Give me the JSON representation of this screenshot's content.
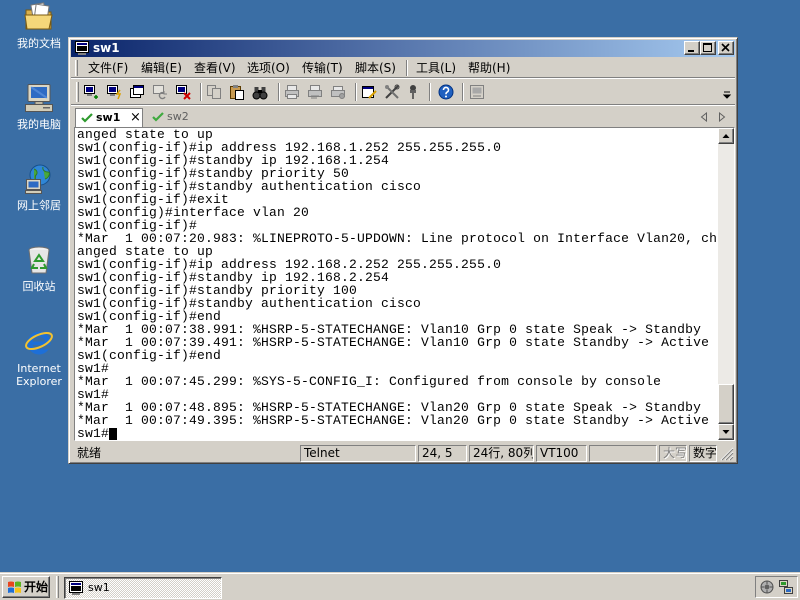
{
  "colors": {
    "desktop": "#3A6EA5",
    "face": "#D4D0C8",
    "title_gradient_start": "#0A246A",
    "title_gradient_end": "#A6CAF0",
    "terminal_background": "#FFFFFF",
    "terminal_text": "#000000"
  },
  "desktop": {
    "icons": [
      {
        "label": "我的文档",
        "icon": "my-documents-icon"
      },
      {
        "label": "我的电脑",
        "icon": "my-computer-icon"
      },
      {
        "label": "网上邻居",
        "icon": "network-places-icon"
      },
      {
        "label": "回收站",
        "icon": "recycle-bin-icon"
      },
      {
        "label": "Internet Explorer",
        "icon": "internet-explorer-icon"
      }
    ]
  },
  "window": {
    "title": "sw1",
    "title_icon": "securecrt-app-icon",
    "menu": [
      "文件(F)",
      "编辑(E)",
      "查看(V)",
      "选项(O)",
      "传输(T)",
      "脚本(S)",
      "工具(L)",
      "帮助(H)"
    ],
    "toolbar": [
      "connect-icon",
      "quick-connect-icon",
      "connect-in-tab-icon",
      "reconnect-icon",
      "disconnect-icon",
      "copy-icon",
      "paste-icon",
      "find-icon",
      "print-icon",
      "print-selection-icon",
      "print-setup-icon",
      "session-options-icon",
      "global-options-icon",
      "keymap-icon",
      "help-icon",
      "chat-window-icon"
    ],
    "tabs": [
      {
        "label": "sw1",
        "active": true,
        "icon": "connected-check-icon",
        "close": "×"
      },
      {
        "label": "sw2",
        "active": false,
        "icon": "connected-check-icon"
      }
    ],
    "terminal": {
      "cursor_style": "block",
      "lines": [
        "anged state to up",
        "sw1(config-if)#ip address 192.168.1.252 255.255.255.0",
        "sw1(config-if)#standby ip 192.168.1.254",
        "sw1(config-if)#standby priority 50",
        "sw1(config-if)#standby authentication cisco",
        "sw1(config-if)#exit",
        "sw1(config)#interface vlan 20",
        "sw1(config-if)#",
        "*Mar  1 00:07:20.983: %LINEPROTO-5-UPDOWN: Line protocol on Interface Vlan20, ch",
        "anged state to up",
        "sw1(config-if)#ip address 192.168.2.252 255.255.255.0",
        "sw1(config-if)#standby ip 192.168.2.254",
        "sw1(config-if)#standby priority 100",
        "sw1(config-if)#standby authentication cisco",
        "sw1(config-if)#end",
        "*Mar  1 00:07:38.991: %HSRP-5-STATECHANGE: Vlan10 Grp 0 state Speak -> Standby",
        "*Mar  1 00:07:39.491: %HSRP-5-STATECHANGE: Vlan10 Grp 0 state Standby -> Active",
        "sw1(config-if)#end",
        "sw1#",
        "*Mar  1 00:07:45.299: %SYS-5-CONFIG_I: Configured from console by console",
        "sw1#",
        "*Mar  1 00:07:48.895: %HSRP-5-STATECHANGE: Vlan20 Grp 0 state Speak -> Standby",
        "*Mar  1 00:07:49.395: %HSRP-5-STATECHANGE: Vlan20 Grp 0 state Standby -> Active",
        "sw1#"
      ]
    },
    "status_bar": {
      "ready": "就绪",
      "protocol": "Telnet",
      "cursor_position": "24, 5",
      "size": "24行, 80列",
      "emulation": "VT100",
      "caps": "大写",
      "num": "数字"
    }
  },
  "taskbar": {
    "start_label": "开始",
    "tasks": [
      {
        "label": "sw1",
        "active": true
      }
    ],
    "tray_icons": [
      "tray-app-icon",
      "tray-network-icon"
    ]
  }
}
